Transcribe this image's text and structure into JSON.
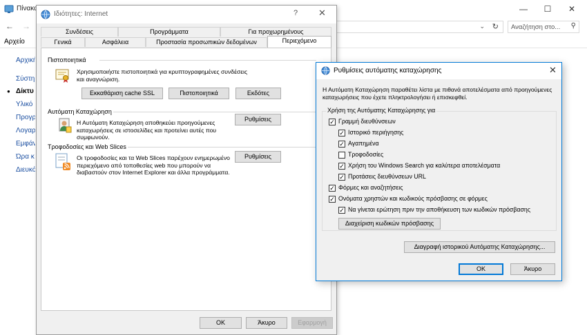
{
  "bg_window": {
    "title": "Πίνακα",
    "search_placeholder": "Αναζήτηση στο...",
    "menu_file": "Αρχείο",
    "sidebar_items": [
      "Αρχική",
      "Σύστη",
      "Δίκτυ",
      "Υλικό",
      "Προγρ",
      "Λογαρ",
      "Εμφάν",
      "Ώρα κ",
      "Διευκό"
    ]
  },
  "props_dialog": {
    "title": "Ιδιότητες: Internet",
    "help": "?",
    "tabs_row1": [
      "Συνδέσεις",
      "Προγράμματα",
      "Για προχωρημένους"
    ],
    "tabs_row2": [
      "Γενικά",
      "Ασφάλεια",
      "Προστασία προσωπικών δεδομένων",
      "Περιεχόμενο"
    ],
    "active_tab": "Περιεχόμενο",
    "certificates": {
      "title": "Πιστοποιητικά",
      "text": "Χρησιμοποιήστε πιστοποιητικά για κρυπτογραφημένες συνδέσεις και αναγνώριση.",
      "btn_clear_ssl": "Εκκαθάριση cache SSL",
      "btn_certificates": "Πιστοποιητικά",
      "btn_publishers": "Εκδότες"
    },
    "autocomplete": {
      "title": "Αυτόματη Καταχώρηση",
      "text": "Η Αυτόματη Καταχώρηση αποθηκεύει προηγούμενες καταχωρήσεις σε ιστοσελίδες και προτείνει αυτές που συμφωνούν.",
      "btn_settings": "Ρυθμίσεις"
    },
    "feeds": {
      "title": "Τροφοδοσίες και Web Slices",
      "text": "Οι τροφοδοσίες και τα Web Slices παρέχουν ενημερωμένο περιεχόμενο από τοποθεσίες web που μπορούν να διαβαστούν στον Internet Explorer και άλλα προγράμματα.",
      "btn_settings": "Ρυθμίσεις"
    },
    "btn_ok": "OK",
    "btn_cancel": "Άκυρο",
    "btn_apply": "Εφαρμογή"
  },
  "ac_dialog": {
    "title": "Ρυθμίσεις αυτόματης καταχώρησης",
    "description": "Η Αυτόματη Καταχώρηση παραθέτει λίστα με πιθανά αποτελέσματα από προηγούμενες καταχωρήσεις που έχετε πληκτρολογήσει ή επισκεφθεί.",
    "group_title": "Χρήση της Αυτόματης Καταχώρησης για",
    "options": [
      {
        "label": "Γραμμή διευθύνσεων",
        "checked": true
      },
      {
        "label": "Ιστορικό περιήγησης",
        "checked": true
      },
      {
        "label": "Αγαπημένα",
        "checked": true
      },
      {
        "label": "Τροφοδοσίες",
        "checked": false
      },
      {
        "label": "Χρήση του Windows Search για καλύτερα αποτελέσματα",
        "checked": true
      },
      {
        "label": "Προτάσεις διευθύνσεων URL",
        "checked": true
      },
      {
        "label": "Φόρμες και αναζητήσεις",
        "checked": true
      },
      {
        "label": "Ονόματα χρηστών και κωδικούς πρόσβασης σε φόρμες",
        "checked": true
      },
      {
        "label": "Να γίνεται ερώτηση πριν την αποθήκευση των κωδικών πρόσβασης",
        "checked": true
      }
    ],
    "btn_manage_passwords": "Διαχείριση κωδικών πρόσβασης",
    "btn_delete_history": "Διαγραφή ιστορικού Αυτόματης Καταχώρησης...",
    "btn_ok": "OK",
    "btn_cancel": "Άκυρο"
  }
}
